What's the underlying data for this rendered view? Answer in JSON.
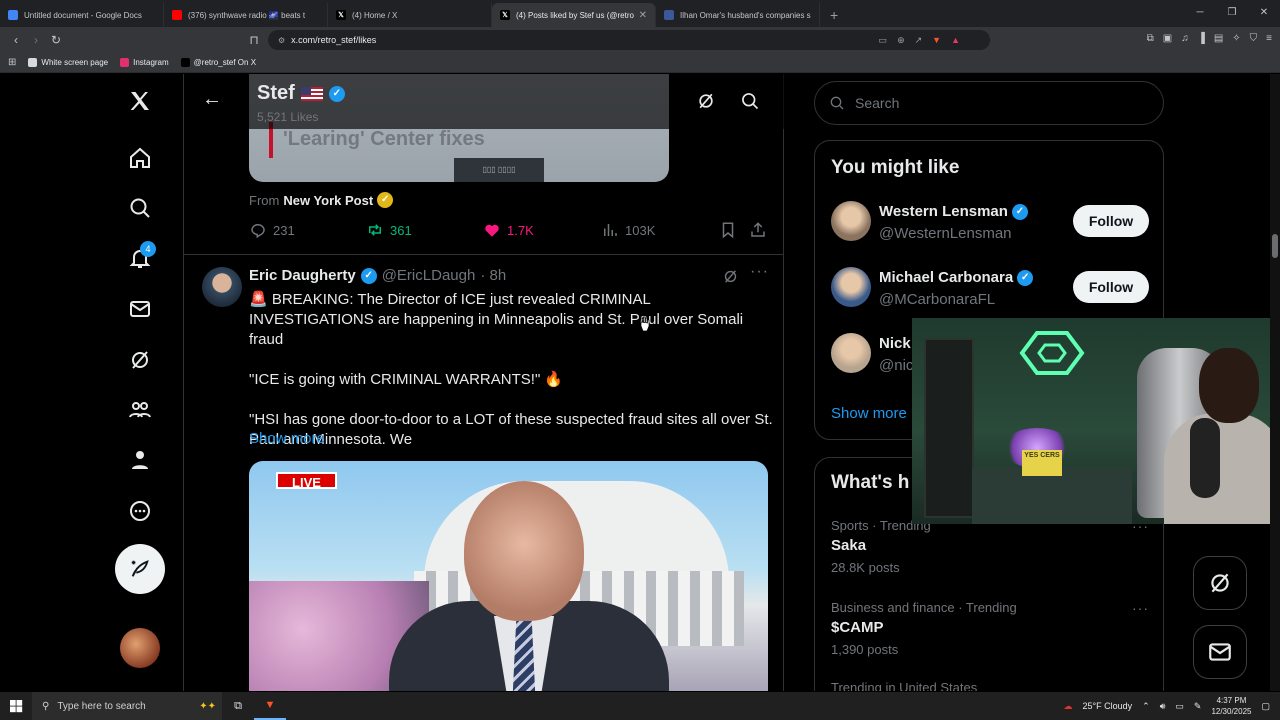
{
  "browser": {
    "tabs": [
      {
        "title": "Untitled document - Google Docs",
        "color": "#4285f4",
        "icon": "docs-icon",
        "active": false
      },
      {
        "title": "(376) synthwave radio 🌌 beats t",
        "color": "#ff0000",
        "icon": "youtube-icon",
        "active": false
      },
      {
        "title": "(4) Home / X",
        "color": "#000000",
        "icon": "x-icon",
        "active": false
      },
      {
        "title": "(4) Posts liked by Stef us (@retro",
        "color": "#000000",
        "icon": "x-icon",
        "active": true
      },
      {
        "title": "Ilhan Omar's husband's companies s",
        "color": "#3b5998",
        "icon": "news-icon",
        "active": false
      }
    ],
    "url": "x.com/retro_stef/likes",
    "bookmarks": [
      {
        "label": "White screen page",
        "color": "#d9d9d9"
      },
      {
        "label": "Instagram",
        "color": "#e1306c"
      },
      {
        "label": "@retro_stef On X",
        "color": "#000000"
      }
    ]
  },
  "x": {
    "notifications_badge": "4",
    "header": {
      "name": "Stef",
      "likes": "5,521 Likes"
    },
    "prev_post": {
      "media_caption": "'Learing' Center fixes",
      "from_label": "From",
      "from_source": "New York Post",
      "replies": "231",
      "reposts": "361",
      "likes": "1.7K",
      "views": "103K"
    },
    "post": {
      "author": "Eric Daugherty",
      "handle": "@EricLDaugh",
      "time": "· 8h",
      "text": [
        "🚨 BREAKING: The Director of ICE just revealed CRIMINAL INVESTIGATIONS are happening in Minneapolis and St. Paul over Somali fraud",
        "\"ICE is going with CRIMINAL WARRANTS!\" 🔥",
        "\"HSI has gone door-to-door to a LOT of these suspected fraud sites all over St. Paul and Minnesota. We"
      ],
      "show_more": "Show more",
      "video_badge": "LIVE"
    },
    "search_placeholder": "Search",
    "you_might_like": {
      "title": "You might like",
      "suggestions": [
        {
          "name": "Western Lensman",
          "handle": "@WesternLensman",
          "follow": "Follow",
          "avatar_color": "#8a7460"
        },
        {
          "name": "Michael Carbonara",
          "handle": "@MCarbonaraFL",
          "follow": "Follow",
          "avatar_color": "#3a5a8a"
        },
        {
          "name": "Nick",
          "handle": "@nic",
          "follow": "",
          "avatar_color": "#b7a48e"
        }
      ],
      "show_more": "Show more"
    },
    "whats_happening": {
      "title": "What's h",
      "trends": [
        {
          "meta": "Sports · Trending",
          "title": "Saka",
          "count": "28.8K posts"
        },
        {
          "meta": "Business and finance · Trending",
          "title": "$CAMP",
          "count": "1,390 posts"
        },
        {
          "meta": "Trending in United States",
          "title": "",
          "count": ""
        }
      ]
    }
  },
  "webcam": {
    "sign_text": "YES CERS"
  },
  "taskbar": {
    "search_placeholder": "Type here to search",
    "weather": "25°F  Cloudy",
    "time": "4:37 PM",
    "date": "12/30/2025"
  }
}
